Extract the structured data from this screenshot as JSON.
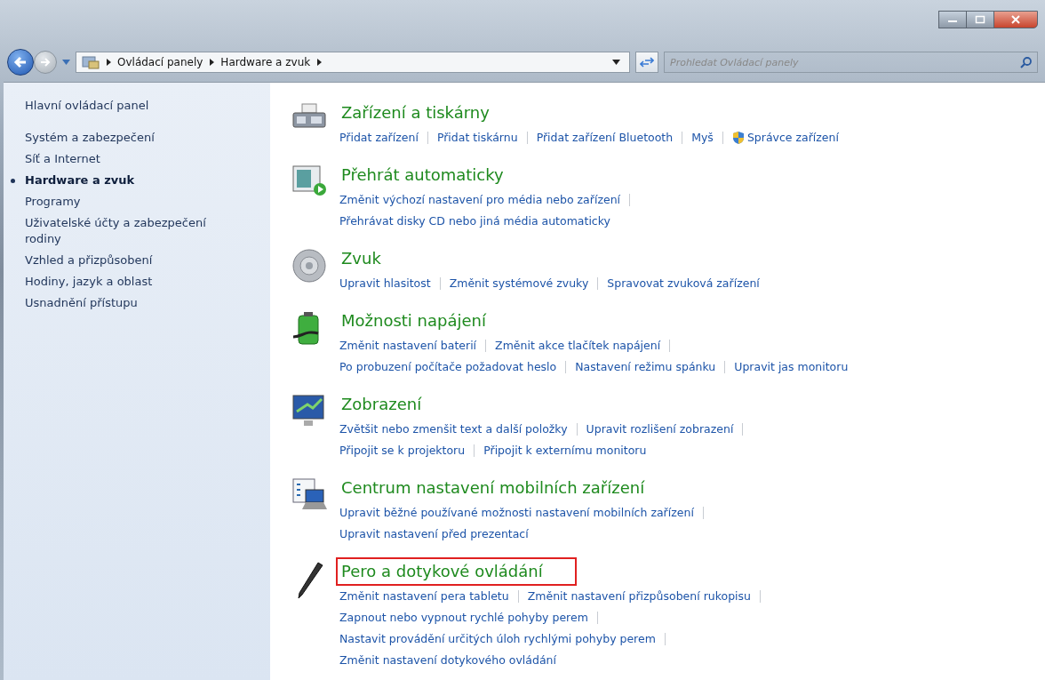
{
  "address_bar": {
    "breadcrumbs": [
      "Ovládací panely",
      "Hardware a zvuk"
    ]
  },
  "search": {
    "placeholder": "Prohledat Ovládací panely"
  },
  "sidebar": {
    "home": "Hlavní ovládací panel",
    "items": [
      {
        "label": "Systém a zabezpečení",
        "selected": false
      },
      {
        "label": "Síť a Internet",
        "selected": false
      },
      {
        "label": "Hardware a zvuk",
        "selected": true
      },
      {
        "label": "Programy",
        "selected": false
      },
      {
        "label": "Uživatelské účty a zabezpečení rodiny",
        "selected": false
      },
      {
        "label": "Vzhled a přizpůsobení",
        "selected": false
      },
      {
        "label": "Hodiny, jazyk a oblast",
        "selected": false
      },
      {
        "label": "Usnadnění přístupu",
        "selected": false
      }
    ]
  },
  "categories": [
    {
      "kind": "printer",
      "title": "Zařízení a tiskárny",
      "highlighted": false,
      "lines": [
        [
          {
            "label": "Přidat zařízení",
            "shield": false
          },
          {
            "label": "Přidat tiskárnu",
            "shield": false
          },
          {
            "label": "Přidat zařízení Bluetooth",
            "shield": false
          },
          {
            "label": "Myš",
            "shield": false
          },
          {
            "label": "Správce zařízení",
            "shield": true
          }
        ]
      ]
    },
    {
      "kind": "autoplay",
      "title": "Přehrát automaticky",
      "highlighted": false,
      "lines": [
        [
          {
            "label": "Změnit výchozí nastavení pro média nebo zařízení",
            "shield": false
          }
        ],
        [
          {
            "label": "Přehrávat disky CD nebo jiná média automaticky",
            "shield": false
          }
        ]
      ]
    },
    {
      "kind": "speaker",
      "title": "Zvuk",
      "highlighted": false,
      "lines": [
        [
          {
            "label": "Upravit hlasitost",
            "shield": false
          },
          {
            "label": "Změnit systémové zvuky",
            "shield": false
          },
          {
            "label": "Spravovat zvuková zařízení",
            "shield": false
          }
        ]
      ]
    },
    {
      "kind": "battery",
      "title": "Možnosti napájení",
      "highlighted": false,
      "lines": [
        [
          {
            "label": "Změnit nastavení baterií",
            "shield": false
          },
          {
            "label": "Změnit akce tlačítek napájení",
            "shield": false
          }
        ],
        [
          {
            "label": "Po probuzení počítače požadovat heslo",
            "shield": false
          },
          {
            "label": "Nastavení režimu spánku",
            "shield": false
          },
          {
            "label": "Upravit jas monitoru",
            "shield": false
          }
        ]
      ]
    },
    {
      "kind": "monitor",
      "title": "Zobrazení",
      "highlighted": false,
      "lines": [
        [
          {
            "label": "Zvětšit nebo zmenšit text a další položky",
            "shield": false
          },
          {
            "label": "Upravit rozlišení zobrazení",
            "shield": false
          }
        ],
        [
          {
            "label": "Připojit se k projektoru",
            "shield": false
          },
          {
            "label": "Připojit k externímu monitoru",
            "shield": false
          }
        ]
      ]
    },
    {
      "kind": "mobility",
      "title": "Centrum nastavení mobilních zařízení",
      "highlighted": false,
      "lines": [
        [
          {
            "label": "Upravit běžné používané možnosti nastavení mobilních zařízení",
            "shield": false
          }
        ],
        [
          {
            "label": "Upravit nastavení před prezentací",
            "shield": false
          }
        ]
      ]
    },
    {
      "kind": "pen",
      "title": "Pero a dotykové ovládání",
      "highlighted": true,
      "lines": [
        [
          {
            "label": "Změnit nastavení pera tabletu",
            "shield": false
          },
          {
            "label": "Změnit nastavení přizpůsobení rukopisu",
            "shield": false
          }
        ],
        [
          {
            "label": "Zapnout nebo vypnout rychlé pohyby perem",
            "shield": false
          }
        ],
        [
          {
            "label": "Nastavit provádění určitých úloh rychlými pohyby perem",
            "shield": false
          }
        ],
        [
          {
            "label": "Změnit nastavení dotykového ovládání",
            "shield": false
          }
        ]
      ]
    }
  ]
}
